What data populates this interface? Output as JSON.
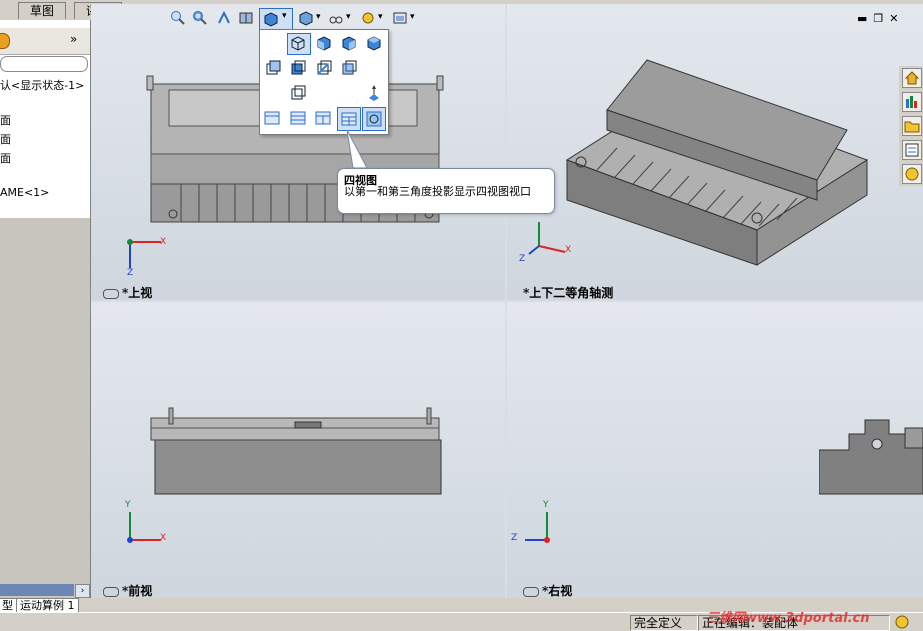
{
  "command_tabs": [
    "草图",
    "评估"
  ],
  "feature_tree": {
    "items": [
      "认<显示状态-1>",
      "面",
      "面",
      "面",
      "AME<1>"
    ]
  },
  "panes": {
    "top_left": {
      "label": "*上视"
    },
    "top_right": {
      "label": "*上下二等角轴测"
    },
    "bottom_left": {
      "label": "*前视"
    },
    "bottom_right": {
      "label": "*右视"
    }
  },
  "axes": {
    "x": "X",
    "y": "Y",
    "z": "Z"
  },
  "tooltip": {
    "title": "四视图",
    "body": "以第一和第三角度投影显示四视图视口"
  },
  "bottom_tabs": [
    "型",
    "运动算例 1"
  ],
  "status": {
    "definition": "完全定义",
    "editing": "正在编辑：装配体"
  },
  "watermark": "三维网www.3dportal.cn",
  "colors": {
    "viewport_bg": "#d8dde6",
    "part_gray": "#8e8e8e",
    "selected_button": "#cfe0f6",
    "accent_blue": "#2a6fc9"
  }
}
